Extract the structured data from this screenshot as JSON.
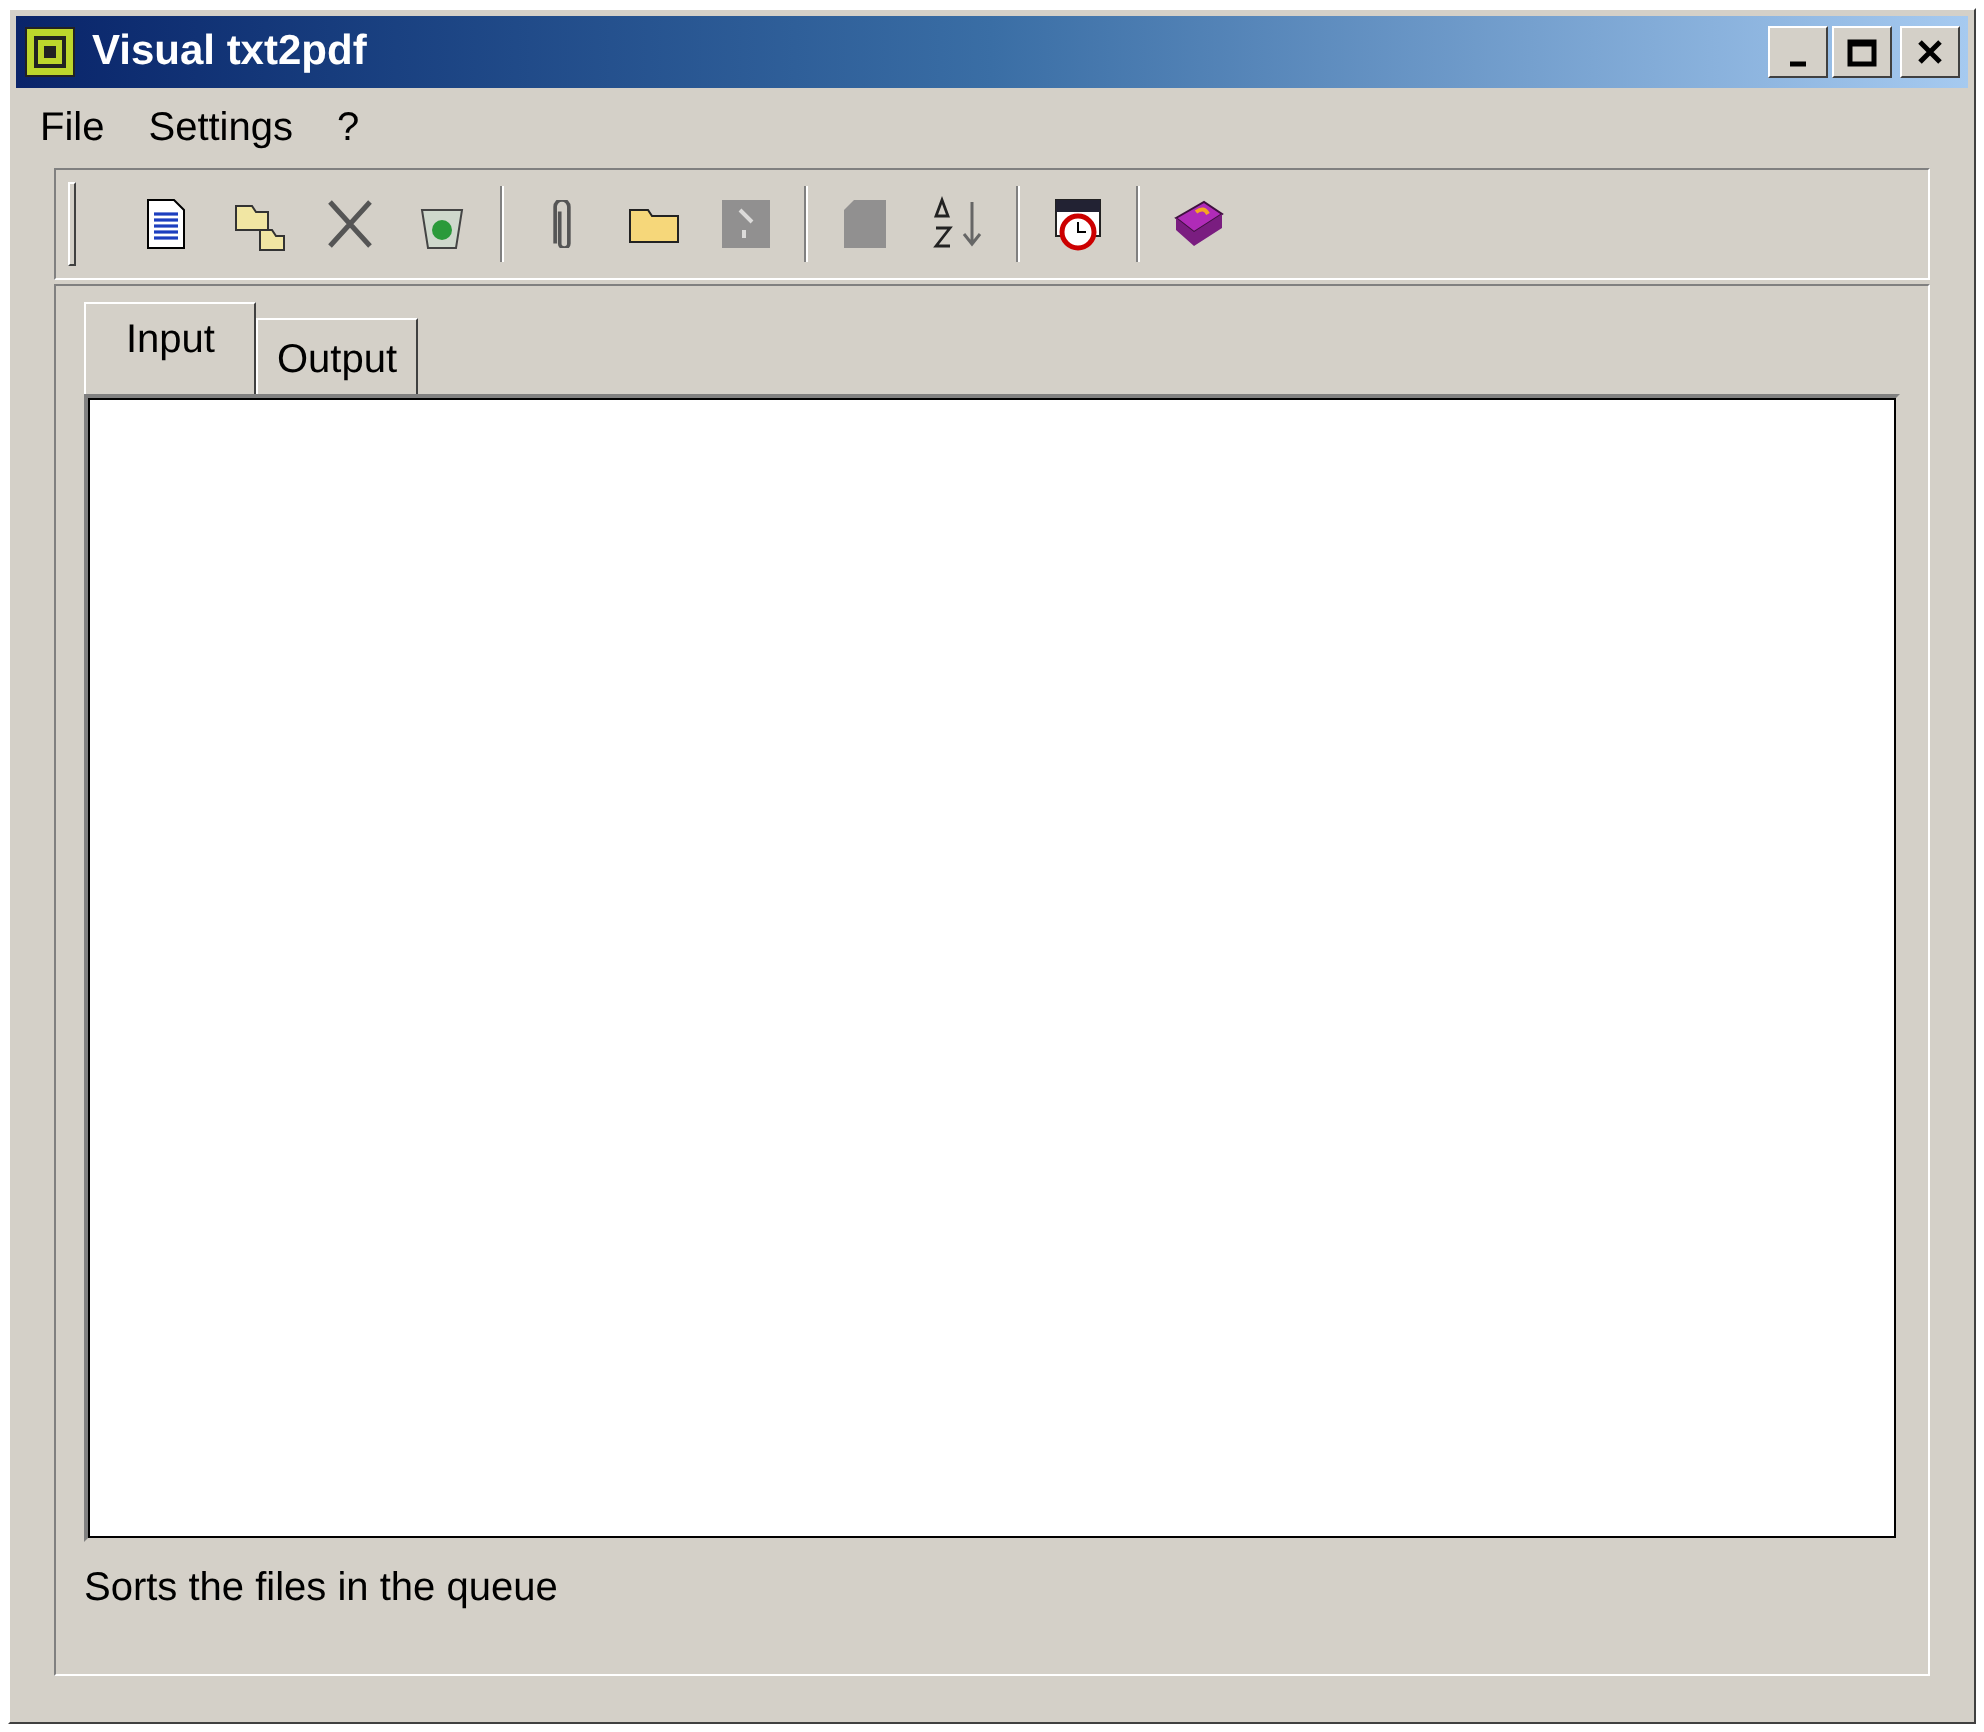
{
  "window": {
    "title": "Visual txt2pdf"
  },
  "menu": [
    "File",
    "Settings",
    "?"
  ],
  "toolbar": [
    [
      {
        "kind": "document",
        "disabled": false
      },
      {
        "kind": "folders",
        "disabled": false
      },
      {
        "kind": "scissors",
        "disabled": false
      },
      {
        "kind": "recycle",
        "disabled": false
      }
    ],
    [
      {
        "kind": "clip",
        "disabled": false
      },
      {
        "kind": "folder",
        "disabled": false
      },
      {
        "kind": "wand",
        "disabled": true
      }
    ],
    [
      {
        "kind": "page",
        "disabled": true
      },
      {
        "kind": "sort",
        "disabled": false
      }
    ],
    [
      {
        "kind": "calendar",
        "disabled": false
      }
    ],
    [
      {
        "kind": "book",
        "disabled": false
      }
    ]
  ],
  "tabs": [
    {
      "label": "Input",
      "selected": true
    },
    {
      "label": "Output",
      "selected": false
    }
  ],
  "status_bar": "Sorts the files in the queue"
}
